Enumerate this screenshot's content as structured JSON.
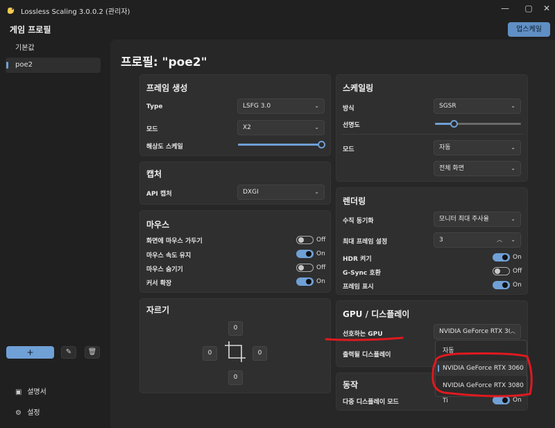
{
  "window": {
    "title": "Lossless Scaling 3.0.0.2 (관리자)",
    "minimize": "—",
    "maximize": "▢",
    "close": "✕"
  },
  "header": {
    "title": "게임 프로필",
    "upscale_label": "업스케일"
  },
  "sidebar": {
    "items": [
      {
        "label": "기본값"
      },
      {
        "label": "poe2"
      }
    ],
    "add": "+",
    "edit": "✎",
    "delete": "🗑",
    "manual": "설명서",
    "settings": "설정"
  },
  "profile": {
    "title": "프로필: \"poe2\""
  },
  "frame_gen": {
    "title": "프레임 생성",
    "type_label": "Type",
    "type_value": "LSFG 3.0",
    "mode_label": "모드",
    "mode_value": "X2",
    "res_scale_label": "해상도 스케일",
    "res_scale_value": 1.0
  },
  "capture": {
    "title": "캡처",
    "api_label": "API 캡처",
    "api_value": "DXGI"
  },
  "mouse": {
    "title": "마우스",
    "rows": [
      {
        "label": "화면에 마우스 가두기",
        "state": "Off"
      },
      {
        "label": "마우스 속도 유지",
        "state": "On"
      },
      {
        "label": "마우스 숨기기",
        "state": "Off"
      },
      {
        "label": "커서 확장",
        "state": "On"
      }
    ]
  },
  "crop": {
    "title": "자르기",
    "top": "0",
    "left": "0",
    "right": "0",
    "bottom": "0"
  },
  "scaling": {
    "title": "스케일링",
    "method_label": "방식",
    "method_value": "SGSR",
    "sharpness_label": "선명도",
    "sharpness_value": 0.22,
    "mode_label": "모드",
    "mode_value": "자동",
    "mode_sub_value": "전체 화면"
  },
  "rendering": {
    "title": "렌더링",
    "vsync_label": "수직 동기화",
    "vsync_value": "모니터 최대 주사율",
    "max_frame_label": "최대 프레임 설정",
    "max_frame_value": "3",
    "hdr_label": "HDR 켜기",
    "hdr_state": "On",
    "gsync_label": "G-Sync 호환",
    "gsync_state": "Off",
    "frame_show_label": "프레임 표시",
    "frame_show_state": "On"
  },
  "gpu": {
    "title": "GPU / 디스플레이",
    "pref_label": "선호하는 GPU",
    "pref_value": "NVIDIA GeForce RTX 30",
    "output_label": "출력될 디스플레이",
    "options": [
      "자동",
      "NVIDIA GeForce RTX 3060",
      "NVIDIA GeForce RTX 3080 Ti"
    ]
  },
  "action": {
    "title": "동작",
    "multi_label": "다중 디스플레이 모드",
    "multi_state": "On"
  },
  "colors": {
    "accent": "#6fa0d6",
    "annotation": "#e0191f"
  }
}
